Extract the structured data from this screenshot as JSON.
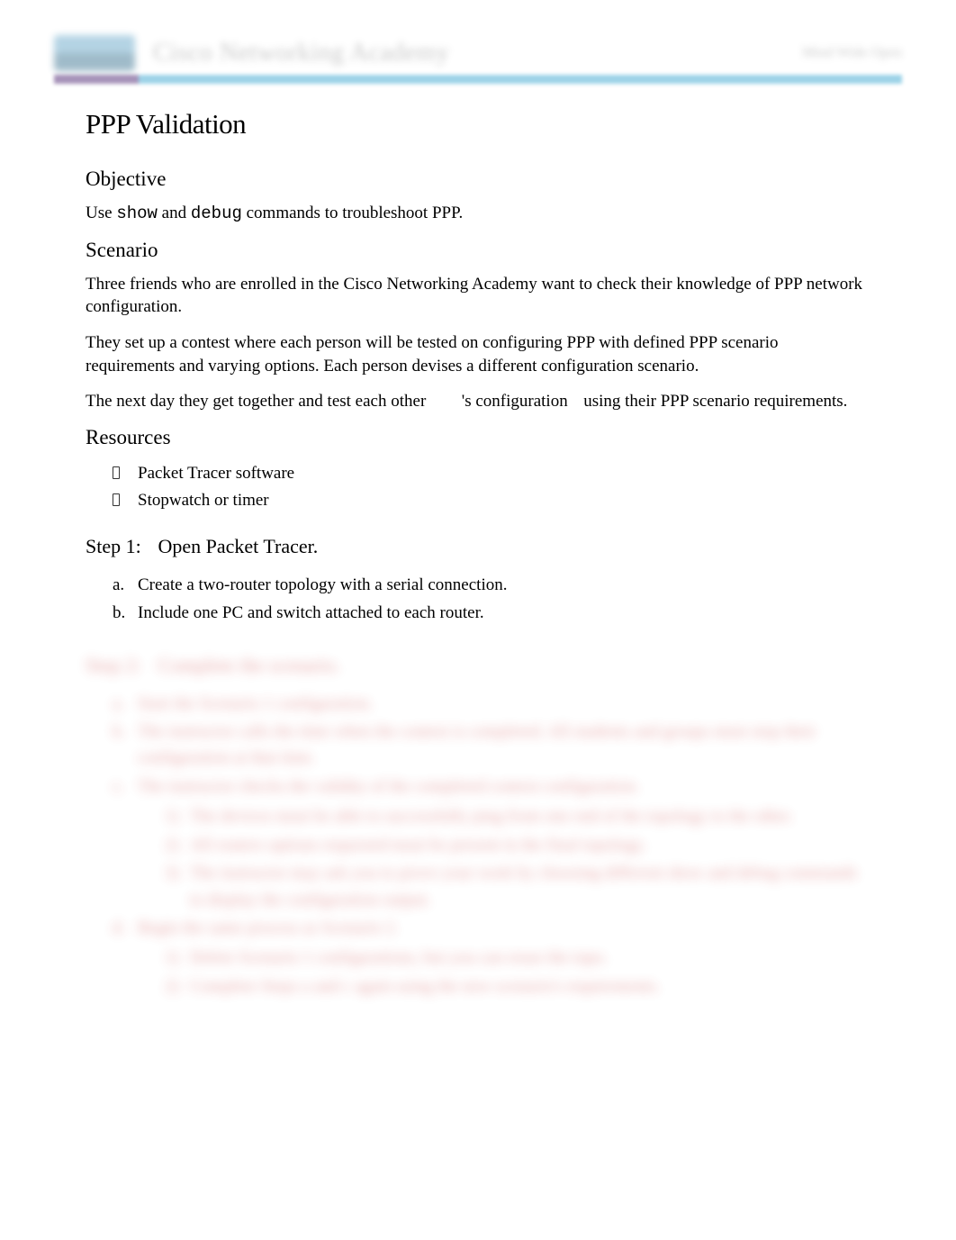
{
  "header": {
    "academy_title": "Cisco Networking Academy",
    "right_text": "Mind Wide Open"
  },
  "doc": {
    "title": "PPP Validation",
    "objective": {
      "heading": "Objective",
      "text_parts": {
        "p1": "Use ",
        "code1": "show",
        "p2": " and ",
        "code2": "debug",
        "p3": " commands to troubleshoot PPP."
      }
    },
    "scenario": {
      "heading": "Scenario",
      "para1": "Three friends who are enrolled in the Cisco Networking Academy want to check their knowledge of PPP network configuration.",
      "para2": "They set up a contest where each person will be tested on configuring PPP with defined PPP scenario requirements and varying options. Each person devises a different configuration scenario.",
      "para3_a": "The next day they get together and test each other",
      "para3_b": "'s configuration",
      "para3_c": "using their PPP scenario requirements."
    },
    "resources": {
      "heading": "Resources",
      "items": [
        "Packet Tracer software",
        "Stopwatch or timer"
      ]
    },
    "step1": {
      "label": "Step 1:",
      "title": "Open Packet Tracer.",
      "items": [
        {
          "marker": "a.",
          "text": "Create a two-router topology with a serial connection."
        },
        {
          "marker": "b.",
          "text": "Include one PC and switch attached to each router."
        }
      ]
    },
    "step2": {
      "label": "Step 2:",
      "title": "Complete the scenario.",
      "items": [
        {
          "marker": "a.",
          "text": "Start the Scenario 1 configuration."
        },
        {
          "marker": "b.",
          "text": "The instructor calls the time when the contest is completed. All students and groups must stop their configuration at that time."
        },
        {
          "marker": "c.",
          "text": "The instructor checks the validity of the completed contest configuration."
        },
        {
          "marker": "d.",
          "text": "Begin the same process as Scenario 2."
        }
      ],
      "sub_c": [
        {
          "marker": "1)",
          "text": "The devices must be able to successfully ping from one end of the topology to the other."
        },
        {
          "marker": "2)",
          "text": "All routers options requested must be present in the final topology."
        },
        {
          "marker": "3)",
          "text": "The instructor may ask you to prove your work by choosing different show and debug commands to display the configuration output."
        }
      ],
      "sub_d": [
        {
          "marker": "1)",
          "text": "Delete Scenario 1 configurations, but you can reuse the topo."
        },
        {
          "marker": "2)",
          "text": "Complete Steps a and c again using the new scenario's requirements."
        }
      ]
    }
  }
}
